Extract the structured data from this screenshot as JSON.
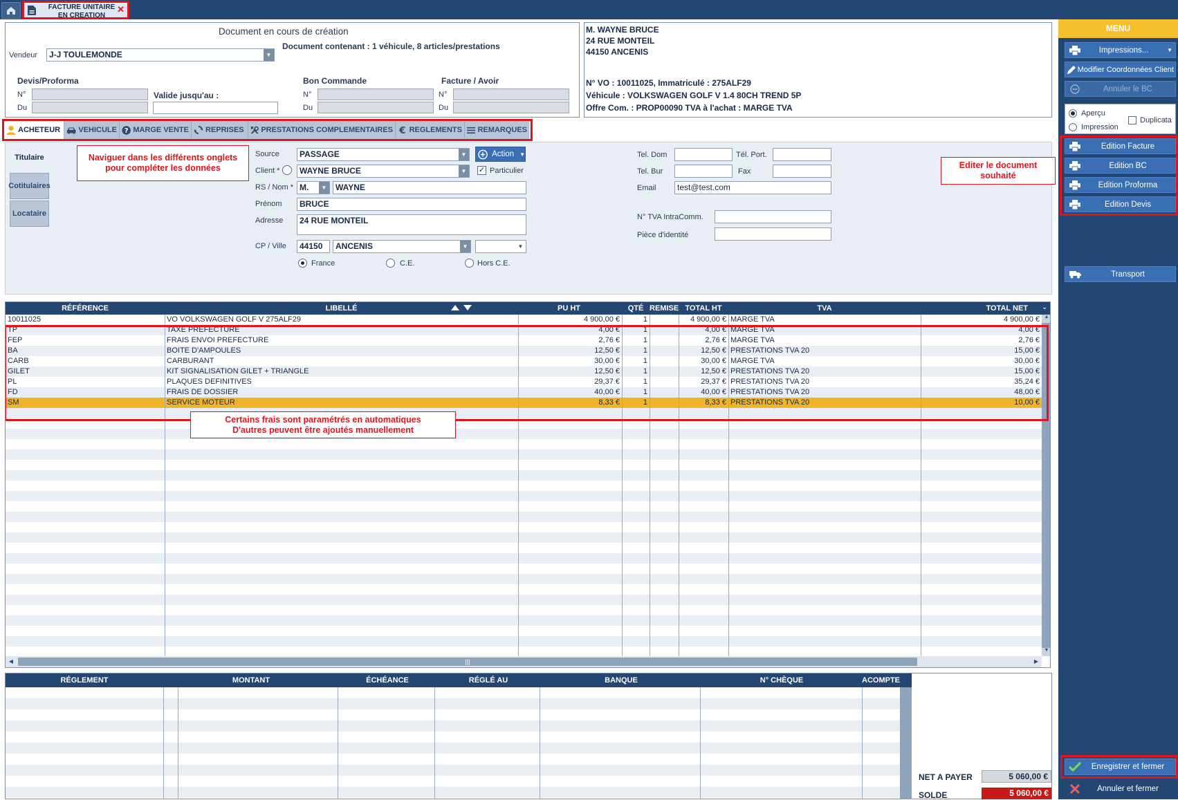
{
  "tab": {
    "line1": "FACTURE UNITAIRE",
    "line2": "EN CREATION"
  },
  "doc": {
    "title": "Document en cours de création",
    "content": "Document contenant : 1 véhicule, 8 articles/prestations",
    "vendeur_label": "Vendeur",
    "vendeur_value": "J-J TOULEMONDE",
    "devis_label": "Devis/Proforma",
    "bon_label": "Bon Commande",
    "facture_label": "Facture / Avoir",
    "no_label": "N°",
    "du_label": "Du",
    "valide_label": "Valide jusqu'au :"
  },
  "client_box": {
    "name": "M. WAYNE BRUCE",
    "street": "24 RUE MONTEIL",
    "city": "44150 ANCENIS",
    "vo": "N° VO : 10011025, Immatriculé : 275ALF29",
    "vehicle": "Véhicule : VOLKSWAGEN GOLF V 1.4 80CH TREND 5P",
    "offer": "Offre Com. : PROP00090 TVA à l'achat : MARGE TVA"
  },
  "tabs": [
    "ACHETEUR",
    "VEHICULE",
    "MARGE VENTE",
    "REPRISES",
    "PRESTATIONS COMPLEMENTAIRES",
    "REGLEMENTS",
    "REMARQUES"
  ],
  "side_tabs": [
    "Titulaire",
    "Cotitulaires",
    "Locataire"
  ],
  "form": {
    "source_label": "Source",
    "source_value": "PASSAGE",
    "action_label": "Action",
    "client_label": "Client *",
    "client_value": "WAYNE BRUCE",
    "particulier_label": "Particulier",
    "rs_label": "RS / Nom *",
    "civ_value": "M.",
    "nom_value": "WAYNE",
    "prenom_label": "Prénom",
    "prenom_value": "BRUCE",
    "adresse_label": "Adresse",
    "adresse_value": "24 RUE MONTEIL",
    "cp_label": "CP / Ville",
    "cp_value": "44150",
    "ville_value": "ANCENIS",
    "france_label": "France",
    "ce_label": "C.E.",
    "horsce_label": "Hors C.E.",
    "teldom_label": "Tel. Dom",
    "telport_label": "Tél. Port.",
    "telbur_label": "Tel. Bur",
    "fax_label": "Fax",
    "email_label": "Email",
    "email_value": "test@test.com",
    "tva_label": "N° TVA IntraComm.",
    "piece_label": "Pièce d'identité"
  },
  "callouts": {
    "tabs": [
      "Naviguer dans les différents onglets",
      "pour compléter les données"
    ],
    "edit": [
      "Editer le document",
      "souhaité"
    ],
    "frais": [
      "Certains frais sont paramétrés en automatiques",
      "D'autres peuvent être ajoutés manuellement"
    ]
  },
  "grid": {
    "headers": [
      "RÉFÉRENCE",
      "LIBELLÉ",
      "PU HT",
      "QTÉ",
      "REMISE",
      "TOTAL HT",
      "TVA",
      "TOTAL NET"
    ],
    "rows": [
      [
        "10011025",
        "VO VOLKSWAGEN GOLF V 275ALF29",
        "4 900,00 €",
        "1",
        "",
        "4 900,00 €",
        "MARGE TVA",
        "4 900,00 €"
      ],
      [
        "TP",
        "TAXE PREFECTURE",
        "4,00 €",
        "1",
        "",
        "4,00 €",
        "MARGE TVA",
        "4,00 €"
      ],
      [
        "FEP",
        "FRAIS ENVOI PREFECTURE",
        "2,76 €",
        "1",
        "",
        "2,76 €",
        "MARGE TVA",
        "2,76 €"
      ],
      [
        "BA",
        "BOITE D'AMPOULES",
        "12,50 €",
        "1",
        "",
        "12,50 €",
        "PRESTATIONS TVA 20",
        "15,00 €"
      ],
      [
        "CARB",
        "CARBURANT",
        "30,00 €",
        "1",
        "",
        "30,00 €",
        "MARGE TVA",
        "30,00 €"
      ],
      [
        "GILET",
        "KIT SIGNALISATION GILET + TRIANGLE",
        "12,50 €",
        "1",
        "",
        "12,50 €",
        "PRESTATIONS TVA 20",
        "15,00 €"
      ],
      [
        "PL",
        "PLAQUES DEFINITIVES",
        "29,37 €",
        "1",
        "",
        "29,37 €",
        "PRESTATIONS TVA 20",
        "35,24 €"
      ],
      [
        "FD",
        "FRAIS DE DOSSIER",
        "40,00 €",
        "1",
        "",
        "40,00 €",
        "PRESTATIONS TVA 20",
        "48,00 €"
      ],
      [
        "SM",
        "SERVICE MOTEUR",
        "8,33 €",
        "1",
        "",
        "8,33 €",
        "PRESTATIONS TVA 20",
        "10,00 €"
      ]
    ]
  },
  "payments": {
    "headers": [
      "RÉGLEMENT",
      "MONTANT",
      "ÉCHÉANCE",
      "RÉGLÉ AU",
      "BANQUE",
      "N° CHÈQUE",
      "ACOMPTE"
    ]
  },
  "totals": {
    "net_label": "NET A PAYER",
    "net_value": "5 060,00 €",
    "solde_label": "SOLDE",
    "solde_value": "5 060,00 €"
  },
  "menu": {
    "title": "MENU",
    "impressions": "Impressions...",
    "modifier": "Modifier Coordonnées Client",
    "annuler_bc": "Annuler le BC",
    "apercu": "Aperçu",
    "impression": "Impression",
    "duplicata": "Duplicata",
    "edition_facture": "Edition Facture",
    "edition_bc": "Edition BC",
    "edition_proforma": "Edition Proforma",
    "edition_devis": "Edition Devis",
    "transport": "Transport",
    "enregistrer": "Enregistrer et fermer",
    "annuler_fermer": "Annuler et fermer"
  },
  "colors": {
    "accent": "#f5c02c",
    "navy": "#244673",
    "button": "#3a6fb4",
    "highlight": "#f0b42a",
    "danger": "#d11a1a",
    "callout": "#e0141e"
  }
}
